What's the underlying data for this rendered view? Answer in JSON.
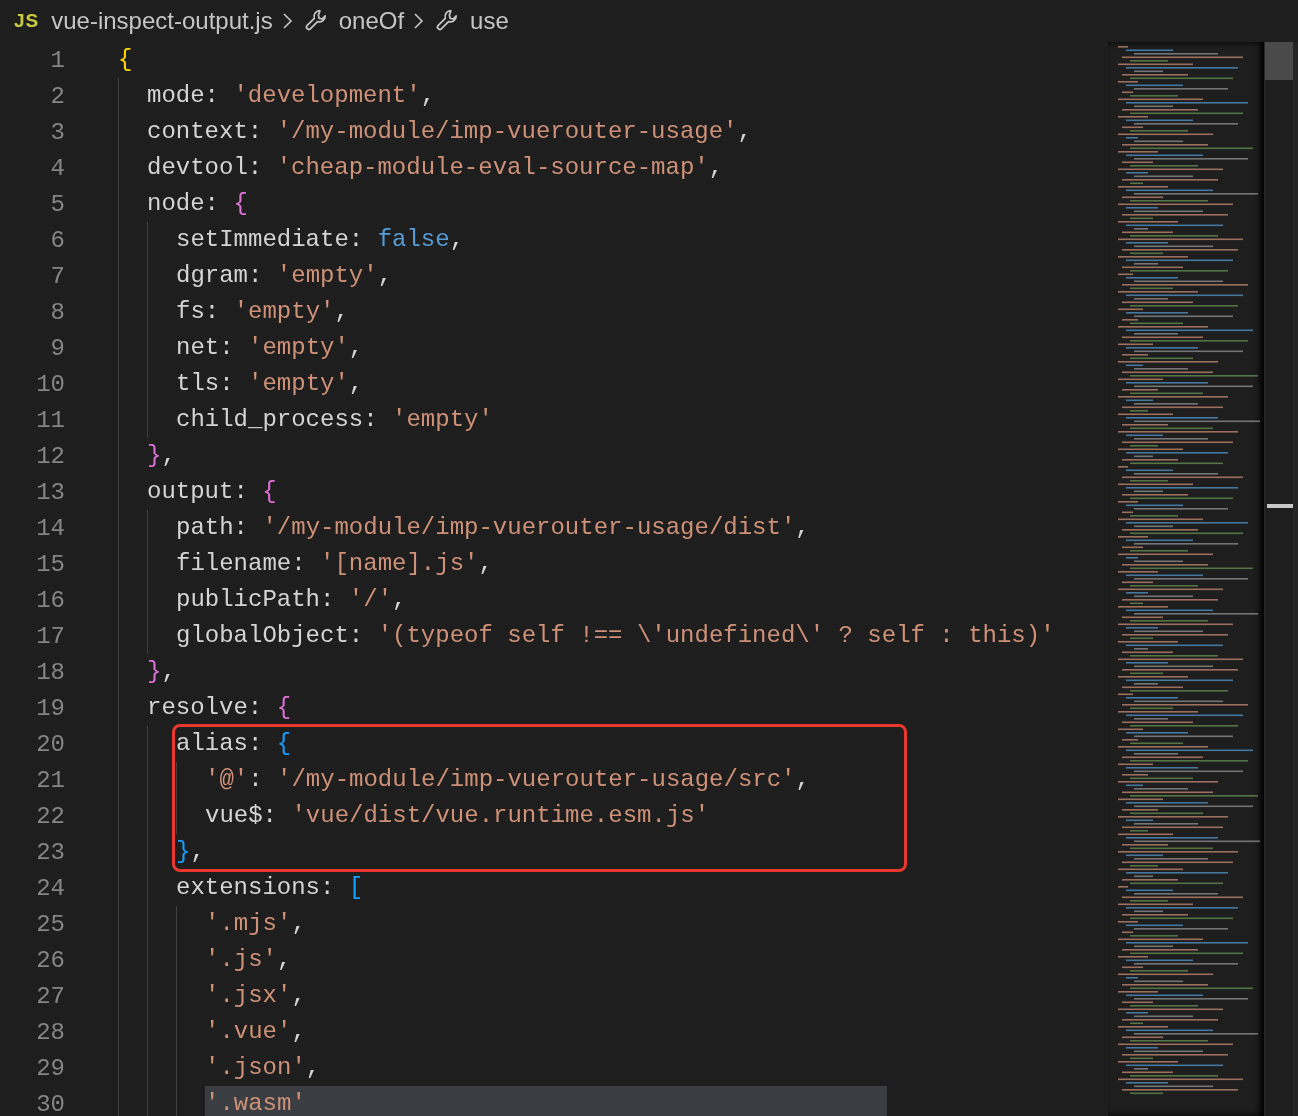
{
  "breadcrumb": {
    "file_badge": "JS",
    "items": [
      {
        "label": "vue-inspect-output.js",
        "kind": "file"
      },
      {
        "label": "oneOf",
        "kind": "symbol"
      },
      {
        "label": "use",
        "kind": "symbol"
      }
    ]
  },
  "editor": {
    "lines": [
      {
        "kind": "line",
        "n": "1",
        "selected": false,
        "tokens": [
          {
            "kind": "bracket",
            "t": "{"
          }
        ],
        "children": [
          {
            "kind": "line",
            "n": "2",
            "selected": false,
            "tokens": [
              {
                "kind": "key",
                "t": "mode"
              },
              {
                "kind": "punct",
                "t": ": "
              },
              {
                "kind": "string",
                "t": "'development'"
              },
              {
                "kind": "punct",
                "t": ","
              }
            ]
          },
          {
            "kind": "line",
            "n": "3",
            "selected": false,
            "tokens": [
              {
                "kind": "key",
                "t": "context"
              },
              {
                "kind": "punct",
                "t": ": "
              },
              {
                "kind": "string",
                "t": "'/my-module/imp-vuerouter-usage'"
              },
              {
                "kind": "punct",
                "t": ","
              }
            ]
          },
          {
            "kind": "line",
            "n": "4",
            "selected": false,
            "tokens": [
              {
                "kind": "key",
                "t": "devtool"
              },
              {
                "kind": "punct",
                "t": ": "
              },
              {
                "kind": "string",
                "t": "'cheap-module-eval-source-map'"
              },
              {
                "kind": "punct",
                "t": ","
              }
            ]
          },
          {
            "kind": "line",
            "n": "5",
            "selected": false,
            "tokens": [
              {
                "kind": "key",
                "t": "node"
              },
              {
                "kind": "punct",
                "t": ": "
              },
              {
                "kind": "bracket",
                "t": "{"
              }
            ],
            "children": [
              {
                "kind": "line",
                "n": "6",
                "selected": false,
                "tokens": [
                  {
                    "kind": "key",
                    "t": "setImmediate"
                  },
                  {
                    "kind": "punct",
                    "t": ": "
                  },
                  {
                    "kind": "keyword",
                    "t": "false"
                  },
                  {
                    "kind": "punct",
                    "t": ","
                  }
                ]
              },
              {
                "kind": "line",
                "n": "7",
                "selected": false,
                "tokens": [
                  {
                    "kind": "key",
                    "t": "dgram"
                  },
                  {
                    "kind": "punct",
                    "t": ": "
                  },
                  {
                    "kind": "string",
                    "t": "'empty'"
                  },
                  {
                    "kind": "punct",
                    "t": ","
                  }
                ]
              },
              {
                "kind": "line",
                "n": "8",
                "selected": false,
                "tokens": [
                  {
                    "kind": "key",
                    "t": "fs"
                  },
                  {
                    "kind": "punct",
                    "t": ": "
                  },
                  {
                    "kind": "string",
                    "t": "'empty'"
                  },
                  {
                    "kind": "punct",
                    "t": ","
                  }
                ]
              },
              {
                "kind": "line",
                "n": "9",
                "selected": false,
                "tokens": [
                  {
                    "kind": "key",
                    "t": "net"
                  },
                  {
                    "kind": "punct",
                    "t": ": "
                  },
                  {
                    "kind": "string",
                    "t": "'empty'"
                  },
                  {
                    "kind": "punct",
                    "t": ","
                  }
                ]
              },
              {
                "kind": "line",
                "n": "10",
                "selected": false,
                "tokens": [
                  {
                    "kind": "key",
                    "t": "tls"
                  },
                  {
                    "kind": "punct",
                    "t": ": "
                  },
                  {
                    "kind": "string",
                    "t": "'empty'"
                  },
                  {
                    "kind": "punct",
                    "t": ","
                  }
                ]
              },
              {
                "kind": "line",
                "n": "11",
                "selected": false,
                "tokens": [
                  {
                    "kind": "key",
                    "t": "child_process"
                  },
                  {
                    "kind": "punct",
                    "t": ": "
                  },
                  {
                    "kind": "string",
                    "t": "'empty'"
                  }
                ]
              }
            ]
          },
          {
            "kind": "line",
            "n": "12",
            "selected": false,
            "tokens": [
              {
                "kind": "bracket",
                "t": "}"
              },
              {
                "kind": "punct",
                "t": ","
              }
            ]
          },
          {
            "kind": "line",
            "n": "13",
            "selected": false,
            "tokens": [
              {
                "kind": "key",
                "t": "output"
              },
              {
                "kind": "punct",
                "t": ": "
              },
              {
                "kind": "bracket",
                "t": "{"
              }
            ],
            "children": [
              {
                "kind": "line",
                "n": "14",
                "selected": false,
                "tokens": [
                  {
                    "kind": "key",
                    "t": "path"
                  },
                  {
                    "kind": "punct",
                    "t": ": "
                  },
                  {
                    "kind": "string",
                    "t": "'/my-module/imp-vuerouter-usage/dist'"
                  },
                  {
                    "kind": "punct",
                    "t": ","
                  }
                ]
              },
              {
                "kind": "line",
                "n": "15",
                "selected": false,
                "tokens": [
                  {
                    "kind": "key",
                    "t": "filename"
                  },
                  {
                    "kind": "punct",
                    "t": ": "
                  },
                  {
                    "kind": "string",
                    "t": "'[name].js'"
                  },
                  {
                    "kind": "punct",
                    "t": ","
                  }
                ]
              },
              {
                "kind": "line",
                "n": "16",
                "selected": false,
                "tokens": [
                  {
                    "kind": "key",
                    "t": "publicPath"
                  },
                  {
                    "kind": "punct",
                    "t": ": "
                  },
                  {
                    "kind": "string",
                    "t": "'/'"
                  },
                  {
                    "kind": "punct",
                    "t": ","
                  }
                ]
              },
              {
                "kind": "line",
                "n": "17",
                "selected": false,
                "tokens": [
                  {
                    "kind": "key",
                    "t": "globalObject"
                  },
                  {
                    "kind": "punct",
                    "t": ": "
                  },
                  {
                    "kind": "string",
                    "t": "'(typeof self !== \\'undefined\\' ? self : this)'"
                  }
                ]
              }
            ]
          },
          {
            "kind": "line",
            "n": "18",
            "selected": false,
            "tokens": [
              {
                "kind": "bracket",
                "t": "}"
              },
              {
                "kind": "punct",
                "t": ","
              }
            ]
          },
          {
            "kind": "line",
            "n": "19",
            "selected": false,
            "tokens": [
              {
                "kind": "key",
                "t": "resolve"
              },
              {
                "kind": "punct",
                "t": ": "
              },
              {
                "kind": "bracket",
                "t": "{"
              }
            ],
            "children": [
              {
                "kind": "box",
                "children": [
                  {
                    "kind": "line",
                    "n": "20",
                    "selected": false,
                    "tokens": [
                      {
                        "kind": "key",
                        "t": "alias"
                      },
                      {
                        "kind": "punct",
                        "t": ": "
                      },
                      {
                        "kind": "bracket",
                        "t": "{"
                      }
                    ],
                    "children": [
                      {
                        "kind": "line",
                        "n": "21",
                        "selected": false,
                        "tokens": [
                          {
                            "kind": "string",
                            "t": "'@'"
                          },
                          {
                            "kind": "punct",
                            "t": ": "
                          },
                          {
                            "kind": "string",
                            "t": "'/my-module/imp-vuerouter-usage/src'"
                          },
                          {
                            "kind": "punct",
                            "t": ","
                          }
                        ]
                      },
                      {
                        "kind": "line",
                        "n": "22",
                        "selected": false,
                        "tokens": [
                          {
                            "kind": "key",
                            "t": "vue$"
                          },
                          {
                            "kind": "punct",
                            "t": ": "
                          },
                          {
                            "kind": "string",
                            "t": "'vue/dist/vue.runtime.esm.js'"
                          }
                        ]
                      }
                    ]
                  },
                  {
                    "kind": "line",
                    "n": "23",
                    "selected": false,
                    "tokens": [
                      {
                        "kind": "bracket",
                        "t": "}"
                      },
                      {
                        "kind": "punct",
                        "t": ","
                      }
                    ]
                  }
                ]
              },
              {
                "kind": "line",
                "n": "24",
                "selected": false,
                "tokens": [
                  {
                    "kind": "key",
                    "t": "extensions"
                  },
                  {
                    "kind": "punct",
                    "t": ": "
                  },
                  {
                    "kind": "bracket",
                    "t": "["
                  }
                ],
                "children": [
                  {
                    "kind": "line",
                    "n": "25",
                    "selected": false,
                    "tokens": [
                      {
                        "kind": "string",
                        "t": "'.mjs'"
                      },
                      {
                        "kind": "punct",
                        "t": ","
                      }
                    ]
                  },
                  {
                    "kind": "line",
                    "n": "26",
                    "selected": false,
                    "tokens": [
                      {
                        "kind": "string",
                        "t": "'.js'"
                      },
                      {
                        "kind": "punct",
                        "t": ","
                      }
                    ]
                  },
                  {
                    "kind": "line",
                    "n": "27",
                    "selected": false,
                    "tokens": [
                      {
                        "kind": "string",
                        "t": "'.jsx'"
                      },
                      {
                        "kind": "punct",
                        "t": ","
                      }
                    ]
                  },
                  {
                    "kind": "line",
                    "n": "28",
                    "selected": false,
                    "tokens": [
                      {
                        "kind": "string",
                        "t": "'.vue'"
                      },
                      {
                        "kind": "punct",
                        "t": ","
                      }
                    ]
                  },
                  {
                    "kind": "line",
                    "n": "29",
                    "selected": false,
                    "tokens": [
                      {
                        "kind": "string",
                        "t": "'.json'"
                      },
                      {
                        "kind": "punct",
                        "t": ","
                      }
                    ]
                  },
                  {
                    "kind": "line",
                    "n": "30",
                    "selected": true,
                    "tokens": [
                      {
                        "kind": "string",
                        "t": "'.wasm'"
                      }
                    ]
                  }
                ]
              }
            ]
          }
        ]
      }
    ]
  }
}
